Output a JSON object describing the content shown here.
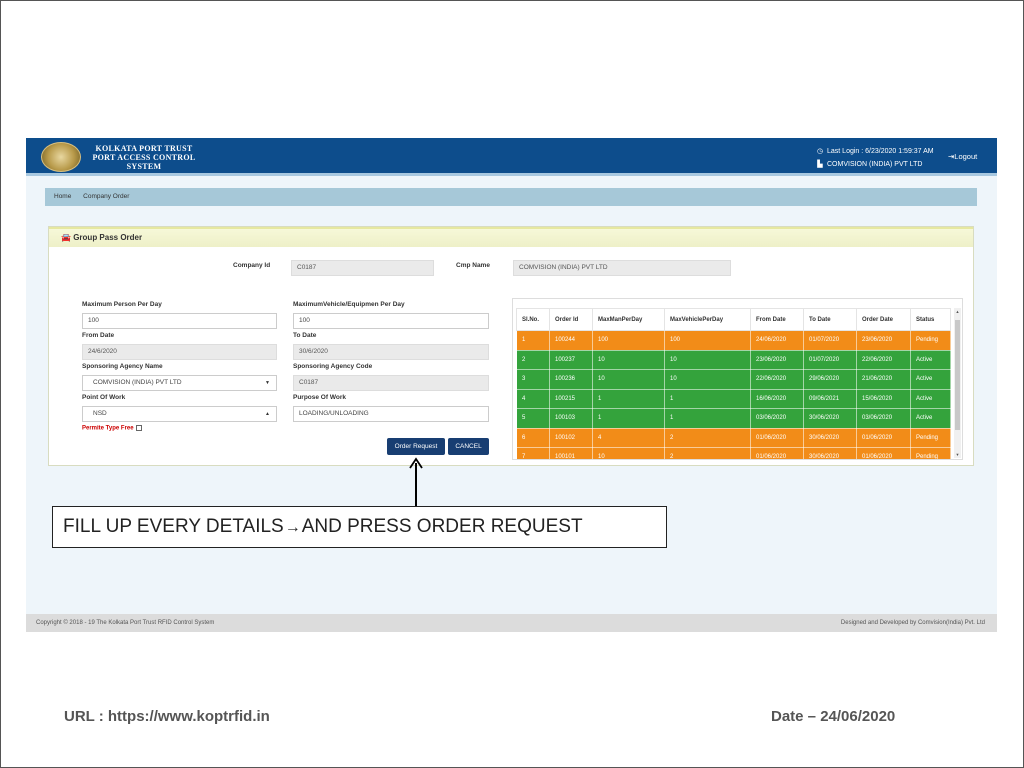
{
  "header": {
    "brand_line1": "KOLKATA PORT TRUST",
    "brand_line2": "PORT ACCESS CONTROL",
    "brand_line3": "SYSTEM",
    "last_login": "Last Login : 6/23/2020 1:59:37 AM",
    "company": "COMVISION (INDIA) PVT LTD",
    "logout_label": "Logout",
    "logout_icon": "logout-icon",
    "clock_icon": "clock-icon",
    "building_icon": "building-icon"
  },
  "breadcrumb": {
    "home": "Home",
    "current": "Company Order"
  },
  "panel": {
    "title": "Group Pass Order",
    "title_icon": "car-icon"
  },
  "form": {
    "company_id_label": "Company Id",
    "company_id_value": "C0187",
    "cmp_name_label": "Cmp Name",
    "cmp_name_value": "COMVISION (INDIA) PVT LTD",
    "max_person_label": "Maximum Person Per Day",
    "max_person_value": "100",
    "max_vehicle_label": "MaximumVehicle/Equipmen Per Day",
    "max_vehicle_value": "100",
    "from_date_label": "From Date",
    "from_date_value": "24/6/2020",
    "to_date_label": "To Date",
    "to_date_value": "30/6/2020",
    "agency_name_label": "Sponsoring Agency Name",
    "agency_name_value": "COMVISION (INDIA) PVT LTD",
    "agency_code_label": "Sponsoring Agency Code",
    "agency_code_value": "C0187",
    "point_label": "Point Of Work",
    "point_value": "NSD",
    "purpose_label": "Purpose Of Work",
    "purpose_value": "LOADING/UNLOADING",
    "permit_label": "Permite Type Free",
    "order_button": "Order Request",
    "cancel_button": "CANCEL"
  },
  "table": {
    "headers": [
      "Sl.No.",
      "Order Id",
      "MaxManPerDay",
      "MaxVehiclePerDay",
      "From Date",
      "To Date",
      "Order Date",
      "Status"
    ],
    "rows": [
      [
        "1",
        "100244",
        "100",
        "100",
        "24/06/2020",
        "01/07/2020",
        "23/06/2020",
        "Pending"
      ],
      [
        "2",
        "100237",
        "10",
        "10",
        "23/06/2020",
        "01/07/2020",
        "22/06/2020",
        "Active"
      ],
      [
        "3",
        "100236",
        "10",
        "10",
        "22/06/2020",
        "29/06/2020",
        "21/06/2020",
        "Active"
      ],
      [
        "4",
        "100215",
        "1",
        "1",
        "16/06/2020",
        "09/06/2021",
        "15/06/2020",
        "Active"
      ],
      [
        "5",
        "100103",
        "1",
        "1",
        "03/06/2020",
        "30/06/2020",
        "03/06/2020",
        "Active"
      ],
      [
        "6",
        "100102",
        "4",
        "2",
        "01/06/2020",
        "30/06/2020",
        "01/06/2020",
        "Pending"
      ],
      [
        "7",
        "100101",
        "10",
        "2",
        "01/06/2020",
        "30/06/2020",
        "01/06/2020",
        "Pending"
      ]
    ]
  },
  "footer": {
    "left": "Copyright © 2018 - 19 The Kolkata Port Trust RFID Control System",
    "right": "Designed and Developed by Comvision(India) Pvt. Ltd"
  },
  "callout": {
    "part1": "FILL UP EVERY DETAILS",
    "arrow": "→",
    "part2": "AND PRESS ORDER REQUEST"
  },
  "slide": {
    "url": "URL : https://www.koptrfid.in",
    "date": "Date – 24/06/2020"
  },
  "colors": {
    "topbar": "#0d4d8c",
    "pending": "#f28c18",
    "active": "#34a33c",
    "button": "#183e72"
  }
}
